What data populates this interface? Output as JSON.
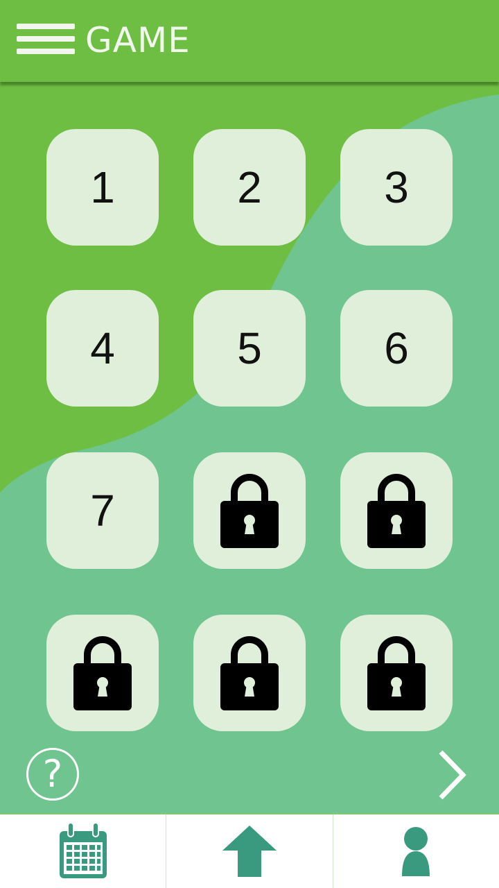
{
  "header": {
    "title": "GAME",
    "menu_icon": "hamburger-menu-icon"
  },
  "colors": {
    "header_green": "#6fbe44",
    "background_teal": "#6fc48f",
    "tile_fill": "#e0efd9",
    "nav_icon_teal": "#3a9a7f"
  },
  "levels": [
    {
      "label": "1",
      "locked": false
    },
    {
      "label": "2",
      "locked": false
    },
    {
      "label": "3",
      "locked": false
    },
    {
      "label": "4",
      "locked": false
    },
    {
      "label": "5",
      "locked": false
    },
    {
      "label": "6",
      "locked": false
    },
    {
      "label": "7",
      "locked": false
    },
    {
      "label": "",
      "locked": true,
      "icon": "lock-icon"
    },
    {
      "label": "",
      "locked": true,
      "icon": "lock-icon"
    },
    {
      "label": "",
      "locked": true,
      "icon": "lock-icon"
    },
    {
      "label": "",
      "locked": true,
      "icon": "lock-icon"
    },
    {
      "label": "",
      "locked": true,
      "icon": "lock-icon"
    }
  ],
  "controls": {
    "help_symbol": "?",
    "help_icon": "question-circle-icon",
    "next_icon": "chevron-right-icon"
  },
  "bottom_nav": [
    {
      "icon": "calendar-icon"
    },
    {
      "icon": "home-arrow-icon"
    },
    {
      "icon": "profile-icon"
    }
  ]
}
